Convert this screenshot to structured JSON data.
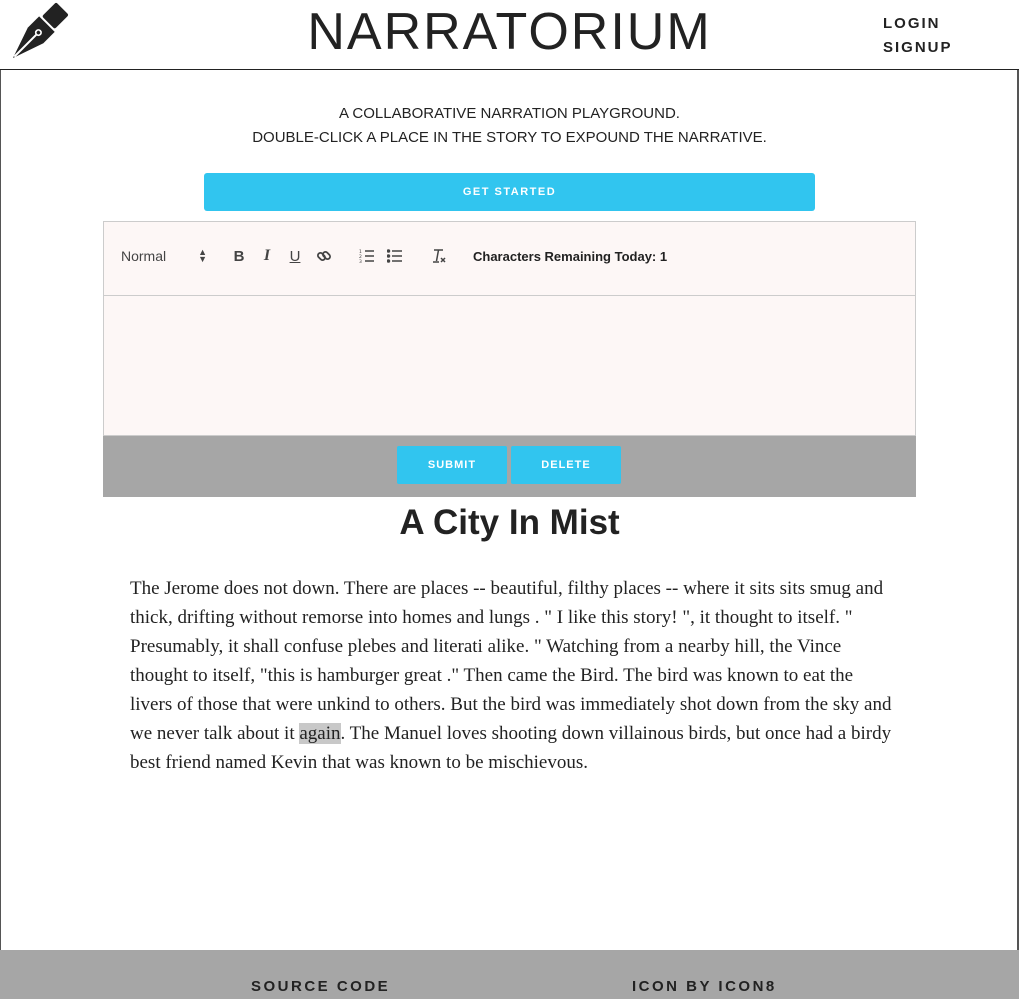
{
  "header": {
    "logo_icon": "fountain-pen-nib-icon",
    "title": "NARRATORIUM",
    "login": "LOGIN",
    "signup": "SIGNUP"
  },
  "intro": {
    "line1": "A COLLABORATIVE NARRATION PLAYGROUND.",
    "line2": "DOUBLE-CLICK A PLACE IN THE STORY TO EXPOUND THE NARRATIVE.",
    "get_started": "GET STARTED"
  },
  "editor": {
    "header_select": "Normal",
    "bold": "B",
    "italic": "I",
    "underline": "U",
    "icons": [
      "link-icon",
      "ordered-list-icon",
      "bullet-list-icon",
      "clear-format-icon"
    ],
    "characters_remaining": "Characters Remaining Today: 1",
    "content": "",
    "submit": "SUBMIT",
    "delete": "DELETE"
  },
  "story": {
    "title": "A City In Mist",
    "text_before": "The Jerome does not down. There are places -- beautiful, filthy places -- where it sits sits smug and thick, drifting without remorse into homes and lungs . \" I like this story! \", it thought to itself. \" Presumably, it shall confuse plebes and literati alike. \" Watching from a nearby hill, the Vince thought to itself, \"this is hamburger great .\" Then came the Bird. The bird was known to eat the livers of those that were unkind to others. But the bird was immediately shot down from the sky and we never talk about it ",
    "highlighted": "again",
    "text_after": ". The Manuel loves shooting down villainous birds, but once had a birdy best friend named Kevin that was known to be mischievous."
  },
  "footer": {
    "source_code": "SOURCE CODE",
    "icon_credit": "ICON BY ICON8"
  },
  "colors": {
    "accent": "#31c5ef",
    "bar_gray": "#a6a6a6",
    "editor_bg": "#fdf7f6",
    "highlight": "#c8c8c8"
  }
}
